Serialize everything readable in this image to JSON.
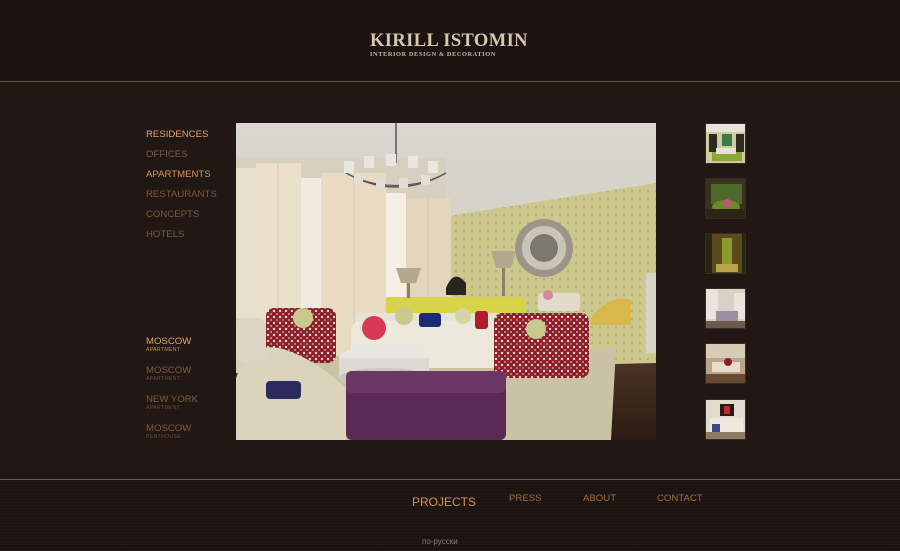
{
  "brand": {
    "title": "KIRILL ISTOMIN",
    "subtitle": "INTERIOR DESIGN & DECORATION"
  },
  "categories": [
    {
      "label": "RESIDENCES"
    },
    {
      "label": "OFFICES"
    },
    {
      "label": "APARTMENTS"
    },
    {
      "label": "RESTAURANTS"
    },
    {
      "label": "CONCEPTS"
    },
    {
      "label": "HOTELS"
    }
  ],
  "projects": [
    {
      "city": "MOSCOW",
      "type": "APARTMENT"
    },
    {
      "city": "MOSCOW",
      "type": "APARTMENT"
    },
    {
      "city": "NEW YORK",
      "type": "APARTMENT"
    },
    {
      "city": "MOSCOW",
      "type": "PENTHOUSE"
    }
  ],
  "nav": {
    "projects": "PROJECTS",
    "press": "PRESS",
    "about": "ABOUT",
    "contact": "CONTACT"
  },
  "language_link": "по-русски",
  "colors": {
    "background": "#1e1512",
    "accent": "#d9904b",
    "active_link": "#e0a56a",
    "inactive_link": "#7d5a3e"
  }
}
